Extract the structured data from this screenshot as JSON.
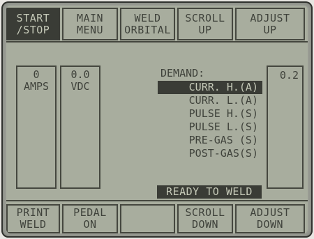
{
  "top_keys": [
    {
      "line1": "START",
      "line2": "/STOP",
      "active": true
    },
    {
      "line1": "MAIN",
      "line2": "MENU"
    },
    {
      "line1": "WELD",
      "line2": "ORBITAL"
    },
    {
      "line1": "SCROLL",
      "line2": "UP"
    },
    {
      "line1": "ADJUST",
      "line2": "UP"
    }
  ],
  "bottom_keys": [
    {
      "line1": "PRINT",
      "line2": "WELD"
    },
    {
      "line1": "PEDAL",
      "line2": "ON"
    },
    {
      "line1": "",
      "line2": ""
    },
    {
      "line1": "SCROLL",
      "line2": "DOWN"
    },
    {
      "line1": "ADJUST",
      "line2": "DOWN"
    }
  ],
  "meters": {
    "amps_value": "0",
    "amps_unit": "AMPS",
    "vdc_value": "0.0",
    "vdc_unit": "VDC"
  },
  "demand": {
    "title": "DEMAND:",
    "items": [
      "CURR. H.(A)",
      "CURR. L.(A)",
      "PULSE H.(S)",
      "PULSE L.(S)",
      "PRE-GAS (S)",
      "POST-GAS(S)"
    ],
    "selected_index": 0,
    "value": "0.2"
  },
  "status": "READY TO WELD",
  "colors": {
    "lcd_background": "#a8ad9e",
    "lcd_ink": "#3a3c36"
  }
}
